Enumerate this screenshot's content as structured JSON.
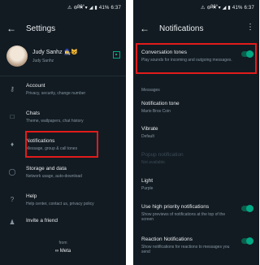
{
  "left": {
    "status": {
      "left": "86°",
      "icons": "⚠ ⊖ ✕ ▾ ◢ ▮",
      "battery": "41%",
      "time": "6:37"
    },
    "title": "Settings",
    "profile": {
      "name": "Judy Sanhz 🧙‍♀️😺",
      "about": "Judy Sanhz"
    },
    "items": [
      {
        "label": "Account",
        "sub": "Privacy, security, change number"
      },
      {
        "label": "Chats",
        "sub": "Theme, wallpapers, chat history"
      },
      {
        "label": "Notifications",
        "sub": "Message, group & call tones"
      },
      {
        "label": "Storage and data",
        "sub": "Network usage, auto-download"
      },
      {
        "label": "Help",
        "sub": "Help center, contact us, privacy policy"
      },
      {
        "label": "Invite a friend",
        "sub": ""
      }
    ],
    "footer": {
      "from": "from",
      "meta": "∞ Meta"
    }
  },
  "right": {
    "status": {
      "left": "86°",
      "icons": "⚠ ⊖ ✕ ▾ ◢ ▮",
      "battery": "41%",
      "time": "6:37"
    },
    "title": "Notifications",
    "conversation": {
      "label": "Conversation tones",
      "sub": "Play sounds for incoming and outgoing messages.",
      "on": true
    },
    "messages_header": "Messages",
    "tone": {
      "label": "Notification tone",
      "sub": "Mario Bros Coin"
    },
    "vibrate": {
      "label": "Vibrate",
      "sub": "Default"
    },
    "popup": {
      "label": "Popup notification",
      "sub": "Not available"
    },
    "light": {
      "label": "Light",
      "sub": "Purple"
    },
    "high_priority": {
      "label": "Use high priority notifications",
      "sub": "Show previews of notifications at the top of the screen",
      "on": true
    },
    "reaction": {
      "label": "Reaction Notifications",
      "sub": "Show notifications for reactions to messages you send",
      "on": true
    }
  },
  "colors": {
    "bg": "#121b22",
    "accent": "#00a884",
    "highlight": "#e21b1b",
    "muted": "#8696a0"
  }
}
